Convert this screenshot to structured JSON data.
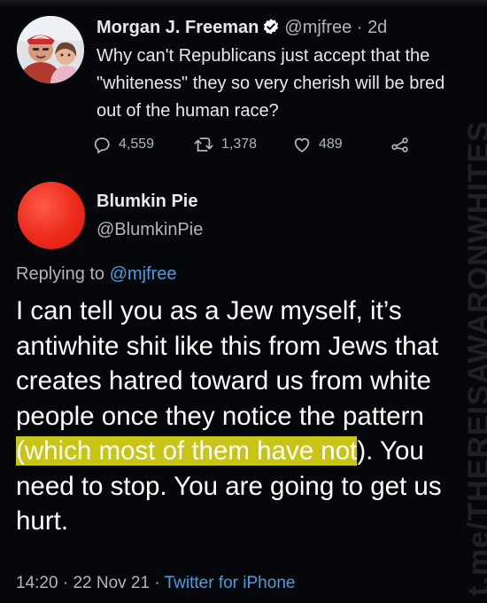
{
  "quoted_tweet": {
    "author_name": "Morgan J. Freeman",
    "handle": "@mjfree",
    "separator": "·",
    "age": "2d",
    "text": "Why can't Republicans just accept that the \"whiteness\" they so very cherish will be bred out of the human race?",
    "actions": {
      "replies": "4,559",
      "retweets": "1,378",
      "likes": "489"
    }
  },
  "reply": {
    "author_name": "Blumkin Pie",
    "handle": "@BlumkinPie",
    "replying_prefix": "Replying to",
    "replying_mention": "@mjfree",
    "text_part1": "I can tell you as a Jew myself, it’s antiwhite shit like this from Jews that creates hatred toward us from white people once they notice the pattern ",
    "text_highlight": "(which most of them have not",
    "text_part2": "). You need to stop. You are going to get us hurt.",
    "time": "14:20",
    "date": "22 Nov 21",
    "separator": "·",
    "source": "Twitter for iPhone"
  },
  "watermark": "t.me/THEREISAWARONWHITES",
  "colors": {
    "background": "#05070a",
    "link": "#4a9ddc",
    "highlight": "#c9c516",
    "reply_avatar": "#ec2a1b",
    "verified_badge": "#ffffff"
  },
  "icons": [
    "verified-badge-icon",
    "reply-icon",
    "retweet-icon",
    "like-icon",
    "share-icon"
  ]
}
